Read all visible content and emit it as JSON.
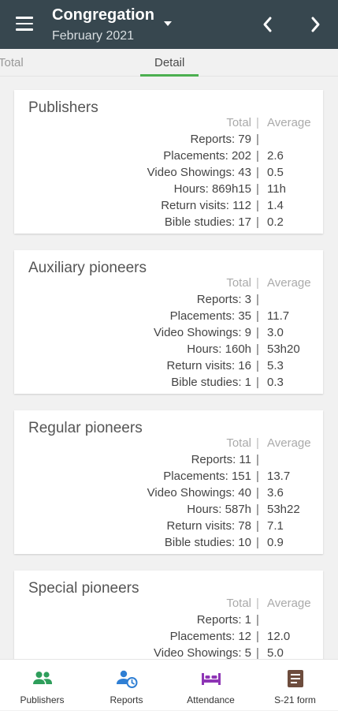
{
  "appbar": {
    "title": "Congregation",
    "subtitle": "February 2021"
  },
  "tabs": [
    {
      "label": "Total"
    },
    {
      "label": "Detail"
    }
  ],
  "columns": {
    "total": "Total",
    "sep": "|",
    "average": "Average"
  },
  "cards": [
    {
      "title": "Publishers",
      "rows": [
        {
          "label": "Reports: 79",
          "avg": ""
        },
        {
          "label": "Placements: 202",
          "avg": "2.6"
        },
        {
          "label": "Video Showings: 43",
          "avg": "0.5"
        },
        {
          "label": "Hours: 869h15",
          "avg": "11h"
        },
        {
          "label": "Return visits: 112",
          "avg": "1.4"
        },
        {
          "label": "Bible studies: 17",
          "avg": "0.2"
        }
      ]
    },
    {
      "title": "Auxiliary pioneers",
      "rows": [
        {
          "label": "Reports: 3",
          "avg": ""
        },
        {
          "label": "Placements: 35",
          "avg": "11.7"
        },
        {
          "label": "Video Showings: 9",
          "avg": "3.0"
        },
        {
          "label": "Hours: 160h",
          "avg": "53h20"
        },
        {
          "label": "Return visits: 16",
          "avg": "5.3"
        },
        {
          "label": "Bible studies: 1",
          "avg": "0.3"
        }
      ]
    },
    {
      "title": "Regular pioneers",
      "rows": [
        {
          "label": "Reports: 11",
          "avg": ""
        },
        {
          "label": "Placements: 151",
          "avg": "13.7"
        },
        {
          "label": "Video Showings: 40",
          "avg": "3.6"
        },
        {
          "label": "Hours: 587h",
          "avg": "53h22"
        },
        {
          "label": "Return visits: 78",
          "avg": "7.1"
        },
        {
          "label": "Bible studies: 10",
          "avg": "0.9"
        }
      ]
    },
    {
      "title": "Special pioneers",
      "rows": [
        {
          "label": "Reports: 1",
          "avg": ""
        },
        {
          "label": "Placements: 12",
          "avg": "12.0"
        },
        {
          "label": "Video Showings: 5",
          "avg": "5.0"
        }
      ]
    }
  ],
  "bottom_nav": [
    {
      "label": "Publishers",
      "icon": "people-icon",
      "color": "#2e9e5b"
    },
    {
      "label": "Reports",
      "icon": "person-clock-icon",
      "color": "#2f7fd4"
    },
    {
      "label": "Attendance",
      "icon": "bed-icon",
      "color": "#8e35b5"
    },
    {
      "label": "S-21 form",
      "icon": "form-icon",
      "color": "#6d4c3d"
    }
  ],
  "colors": {
    "appbar": "#37474f",
    "accent": "#4caf50"
  }
}
